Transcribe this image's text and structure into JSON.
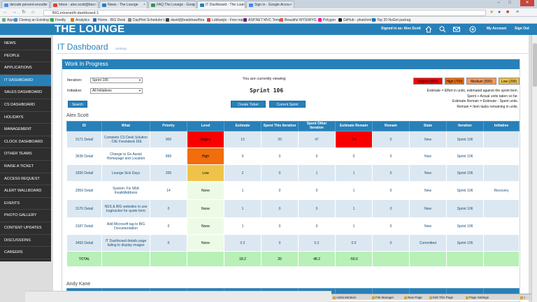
{
  "browser": {
    "tabs": [
      {
        "label": "decode percent-encode",
        "color": "#4a8bd4"
      },
      {
        "label": "Inbox - alex.scott@bou",
        "color": "#d44638"
      },
      {
        "label": "News - The Lounge",
        "color": "#2780b8"
      },
      {
        "label": "FAQ The Lounge - Goog",
        "color": "#3a8f5c"
      },
      {
        "label": "IT Dashboard - The Loun",
        "color": "#2780b8"
      },
      {
        "label": "Sign in - Google Accou",
        "color": "#4285f4"
      }
    ],
    "url": "BIG.intranet/it-dashboard-1",
    "bookmarks": [
      {
        "label": "Apps",
        "color": "#6a8"
      },
      {
        "label": "Cloning an Existing F",
        "color": "#4a8bd4"
      },
      {
        "label": "Feedly",
        "color": "#2bb24c"
      },
      {
        "label": "Analytics",
        "color": "#e37400"
      },
      {
        "label": "Home - BIG Desk",
        "color": "#3b66b0"
      },
      {
        "label": "DayPilot Scheduler Li",
        "color": "#888"
      },
      {
        "label": "david@bradshaw/fina",
        "color": "#444"
      },
      {
        "label": "Lobkanjis - Free repos",
        "color": "#c44"
      },
      {
        "label": "ASP.NET MVC Templ",
        "color": "#68217a"
      },
      {
        "label": "Beautiful WYSIWYG",
        "color": "#d55"
      },
      {
        "label": "Polygon",
        "color": "#f0a"
      },
      {
        "label": "GitHub - phatchm/Co",
        "color": "#222"
      },
      {
        "label": "Top 20 NuGet packag",
        "color": "#0a78c2"
      }
    ]
  },
  "header": {
    "logo": "THE LOUNGE",
    "signed_in": "Signed in as: Alex Scott",
    "my_account": "My Account",
    "sign_out": "Sign Out"
  },
  "sidebar": {
    "items": [
      {
        "label": "NEWS",
        "active": false
      },
      {
        "label": "PEOPLE",
        "active": false
      },
      {
        "label": "APPLICATIONS",
        "active": false
      },
      {
        "label": "IT DASHBOARD",
        "active": true
      },
      {
        "label": "SALES DASHBOARD",
        "active": false
      },
      {
        "label": "CS DASHBOARD",
        "active": false
      },
      {
        "label": "HOLIDAYS",
        "active": false
      },
      {
        "label": "MANAGEMENT",
        "active": false
      },
      {
        "label": "CLOCK DASHBOARD",
        "active": false
      },
      {
        "label": "OTHER TEAMS",
        "active": false
      },
      {
        "label": "RAISE A TICKET",
        "active": false
      },
      {
        "label": "ACCESS REQUEST",
        "active": false
      },
      {
        "label": "ALERT WALLBOARD",
        "active": false
      },
      {
        "label": "EVENTS",
        "active": false
      },
      {
        "label": "PHOTO GALLERY",
        "active": false
      },
      {
        "label": "CONTENT UPDATES",
        "active": false
      },
      {
        "label": "DISCUSSIONS",
        "active": false
      },
      {
        "label": "CAREERS",
        "active": false
      }
    ]
  },
  "page": {
    "title": "IT Dashboard",
    "settings": "Settings",
    "wip_title": "Work In Progress",
    "iteration_label": "Iteration:",
    "iteration_value": "Sprint 106",
    "initiative_label": "Initiative:",
    "initiative_value": "All Initiatives",
    "search_btn": "Search",
    "viewing_label": "You are currently viewing:",
    "viewing_sprint": "Sprint 106",
    "create_ticket_btn": "Create Ticket",
    "current_sprint_btn": "Current Sprint",
    "legend": [
      {
        "label": "Urgent (900)",
        "color": "#f80000"
      },
      {
        "label": "High (700)",
        "color": "#f26d0c"
      },
      {
        "label": "Medium (500)",
        "color": "#f59a5a"
      },
      {
        "label": "Low (200)",
        "color": "#efc34a"
      }
    ],
    "notes": [
      "Estimate = Effort in units, estimated against the sprint item.",
      "Spent + Actual units taken so far.",
      "Estimate Remain = Estimate - Spent units.",
      "Remain = Item tasks remaining in units."
    ],
    "person1": "Alex Scott",
    "person2": "Andy Kane"
  },
  "table": {
    "headers": [
      "ID",
      "What",
      "Priority",
      "Level",
      "Estimate",
      "Spent This Iteration",
      "Spent Other Iteration",
      "Estimate Remain",
      "Remain",
      "State",
      "Iteration",
      "Initiative"
    ],
    "rows": [
      {
        "id": "3171",
        "detail": "Detail",
        "what": "Complete CS Desk Solution - DIE Freshdesk DIE",
        "priority": "900",
        "level": "Urgent",
        "level_class": "lvl-urgent",
        "estimate": "13",
        "spent_this": "20",
        "spent_other": "47",
        "est_remain": "-54",
        "rem_neg": true,
        "remain": "0",
        "state": "New",
        "iteration": "Sprint 106",
        "initiative": ""
      },
      {
        "id": "3638",
        "detail": "Detail",
        "what": "Change to Go Assist Homepage and Location",
        "priority": "899",
        "level": "High",
        "level_class": "lvl-high",
        "estimate": "0",
        "spent_this": "0",
        "spent_other": "0",
        "est_remain": "0",
        "rem_neg": false,
        "remain": "0",
        "state": "New",
        "iteration": "Sprint 106",
        "initiative": ""
      },
      {
        "id": "3390",
        "detail": "Detail",
        "what": "Lounge Sick Days",
        "priority": "200",
        "level": "Low",
        "level_class": "lvl-low",
        "estimate": "2",
        "spent_this": "0",
        "spent_other": "1",
        "est_remain": "1",
        "rem_neg": false,
        "remain": "0",
        "state": "New",
        "iteration": "Sprint 106",
        "initiative": ""
      },
      {
        "id": "2959",
        "detail": "Detail",
        "what": "System: Fix SRA InvalidAddress",
        "priority": "14",
        "level": "None",
        "level_class": "lvl-none",
        "estimate": "1",
        "spent_this": "0",
        "spent_other": "0",
        "est_remain": "1",
        "rem_neg": false,
        "remain": "0",
        "state": "New",
        "iteration": "Sprint 106",
        "initiative": "Recovery"
      },
      {
        "id": "3176",
        "detail": "Detail",
        "what": "NSS & BIG websites to use bugtracker for quote form",
        "priority": "0",
        "level": "None",
        "level_class": "lvl-none",
        "estimate": "1",
        "spent_this": "0",
        "spent_other": "0",
        "est_remain": "1",
        "rem_neg": false,
        "remain": "0",
        "state": "New",
        "iteration": "Sprint 106",
        "initiative": ""
      },
      {
        "id": "3187",
        "detail": "Detail",
        "what": "Add Microsoft tag to BIG Documentation",
        "priority": "0",
        "level": "None",
        "level_class": "lvl-none",
        "estimate": "1",
        "spent_this": "0",
        "spent_other": "0",
        "est_remain": "1",
        "rem_neg": false,
        "remain": "0",
        "state": "New",
        "iteration": "Sprint 106",
        "initiative": ""
      },
      {
        "id": "3493",
        "detail": "Detail",
        "what": "IT Dashboard details page failing to display images",
        "priority": "0",
        "level": "None",
        "level_class": "lvl-none",
        "estimate": "0.2",
        "spent_this": "0",
        "spent_other": "0.2",
        "est_remain": "0.0",
        "rem_neg": false,
        "remain": "0",
        "state": "Committed",
        "iteration": "Sprint 106",
        "initiative": ""
      }
    ],
    "total": {
      "label": "TOTAL",
      "estimate": "18.2",
      "spent_this": "20",
      "spent_other": "48.2",
      "est_remain": "-50.0"
    },
    "next_headers": [
      "Spent This",
      "Spent Other"
    ]
  },
  "bottom_bar": [
    "Administration",
    "File Manager",
    "New Page",
    "Edit This Page",
    "Page Settings"
  ]
}
